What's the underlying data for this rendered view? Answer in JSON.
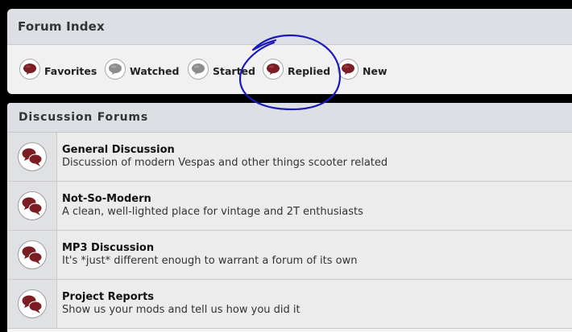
{
  "forum_index": {
    "title": "Forum Index",
    "filters": [
      {
        "label": "Favorites",
        "icon": "red-speech-bubble-icon"
      },
      {
        "label": "Watched",
        "icon": "gray-speech-bubble-icon"
      },
      {
        "label": "Started",
        "icon": "gray-speech-bubble-icon"
      },
      {
        "label": "Replied",
        "icon": "red-speech-bubble-icon"
      },
      {
        "label": "New",
        "icon": "red-speech-bubble-icon"
      }
    ]
  },
  "discussion_forums": {
    "title": "Discussion Forums",
    "forums": [
      {
        "name": "General Discussion",
        "description": "Discussion of modern Vespas and other things scooter related"
      },
      {
        "name": "Not-So-Modern",
        "description": "A clean, well-lighted place for vintage and 2T enthusiasts"
      },
      {
        "name": "MP3 Discussion",
        "description": "It's *just* different enough to warrant a forum of its own"
      },
      {
        "name": "Project Reports",
        "description": "Show us your mods and tell us how you did it"
      }
    ]
  },
  "colors": {
    "bubble_red": "#7a1e24",
    "bubble_gray": "#8c8c8c",
    "annotation_blue": "#1a1ab8",
    "header_bg": "#dcdfe3"
  }
}
